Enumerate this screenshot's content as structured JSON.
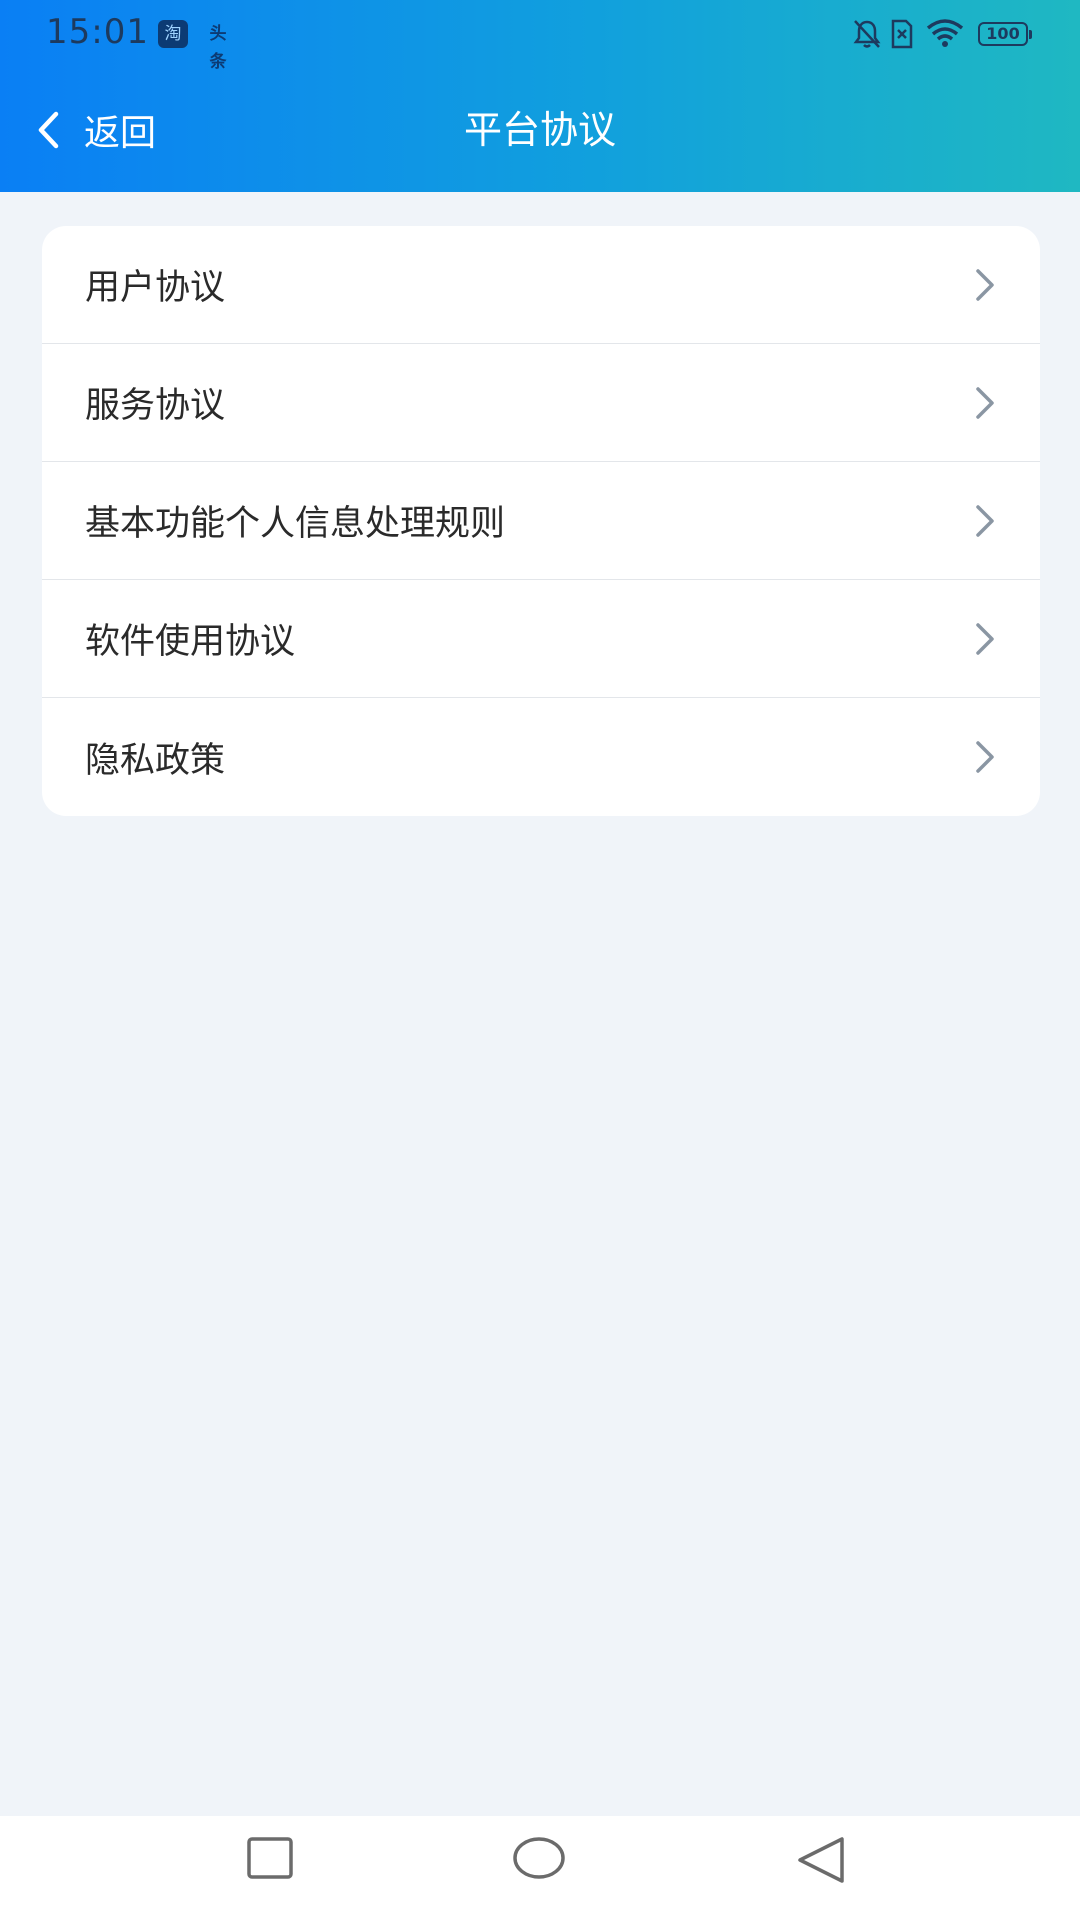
{
  "status_bar": {
    "time": "15:01",
    "app_icons": [
      "taobao-icon",
      "toutiao-icon"
    ],
    "taobao_text": "淘",
    "toutiao_text": "头条",
    "battery": "100",
    "right_icons": [
      "bell-off-icon",
      "sim-off-icon",
      "wifi-icon",
      "battery-icon"
    ]
  },
  "header": {
    "back_label": "返回",
    "title": "平台协议",
    "gradient_colors": [
      "#0a7ff5",
      "#1fb8c2"
    ]
  },
  "menu": {
    "items": [
      {
        "label": "用户协议"
      },
      {
        "label": "服务协议"
      },
      {
        "label": "基本功能个人信息处理规则"
      },
      {
        "label": "软件使用协议"
      },
      {
        "label": "隐私政策"
      }
    ]
  },
  "system_nav": {
    "buttons": [
      "recent-apps-icon",
      "home-icon",
      "back-triangle-icon"
    ]
  },
  "colors": {
    "background": "#f0f4f9",
    "card": "#ffffff",
    "chevron": "#8a96a3"
  }
}
